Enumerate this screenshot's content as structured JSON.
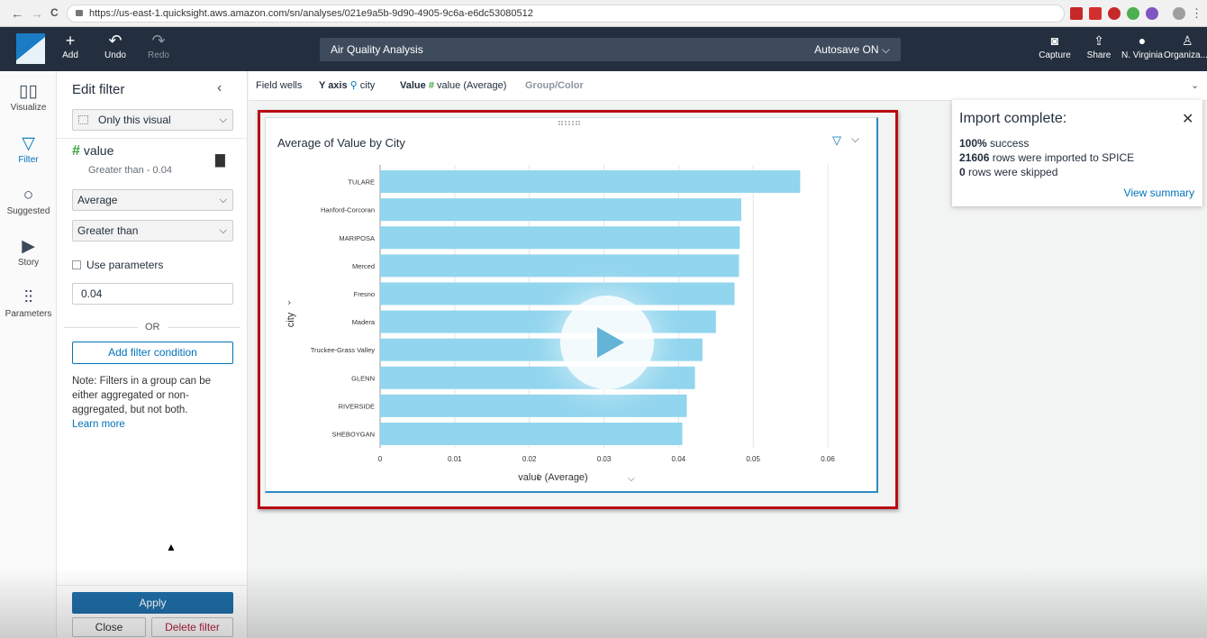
{
  "browser": {
    "url": "https://us-east-1.quicksight.aws.amazon.com/sn/analyses/021e9a5b-9d90-4905-9c6a-e6dc53080512",
    "back_icon": "←",
    "forward_icon": "→",
    "reload_icon": "C"
  },
  "toolbar": {
    "add": "Add",
    "undo": "Undo",
    "redo": "Redo",
    "analysis_name": "Air Quality Analysis",
    "autosave": "Autosave ON",
    "capture": "Capture",
    "share": "Share",
    "region": "N. Virginia",
    "account": "Organiza..."
  },
  "rail": {
    "visualize": "Visualize",
    "filter": "Filter",
    "suggested": "Suggested",
    "story": "Story",
    "parameters": "Parameters"
  },
  "filter_panel": {
    "title": "Edit filter",
    "scope": "Only this visual",
    "field": "value",
    "summary": "Greater than - 0.04",
    "aggregation": "Average",
    "condition": "Greater than",
    "use_parameters": "Use parameters",
    "value": "0.04",
    "or": "OR",
    "add_condition": "Add filter condition",
    "note": "Note: Filters in a group can be either aggregated or non-aggregated, but not both.",
    "learn_more": "Learn more",
    "apply": "Apply",
    "close": "Close",
    "delete": "Delete filter"
  },
  "field_wells": {
    "label": "Field wells",
    "y_axis_label": "Y axis",
    "y_axis_field": "city",
    "value_label": "Value",
    "value_field": "value (Average)",
    "group_label": "Group/Color"
  },
  "toast": {
    "title": "Import complete:",
    "line1_bold": "100%",
    "line1_rest": "success",
    "line2_bold": "21606",
    "line2_rest": "rows were imported to SPICE",
    "line3_bold": "0",
    "line3_rest": "rows were skipped",
    "link": "View summary"
  },
  "colors": {
    "bar": "#91d5ee",
    "accent": "#0073bb",
    "appbar": "#232f3e",
    "highlight": "#b80c13"
  },
  "chart_data": {
    "type": "bar",
    "orientation": "horizontal",
    "title": "Average of Value by City",
    "xlabel": "value (Average)",
    "ylabel": "city",
    "categories": [
      "TULARE",
      "Hanford-Corcoran",
      "MARIPOSA",
      "Merced",
      "Fresno",
      "Madera",
      "Truckee-Grass Valley",
      "GLENN",
      "RIVERSIDE",
      "SHEBOYGAN"
    ],
    "values": [
      0.0563,
      0.0484,
      0.0482,
      0.0481,
      0.0475,
      0.045,
      0.0432,
      0.0422,
      0.0411,
      0.0405
    ],
    "xlim": [
      0,
      0.06
    ],
    "xticks": [
      "0",
      "0.01",
      "0.02",
      "0.03",
      "0.04",
      "0.05",
      "0.06"
    ],
    "grid": true
  }
}
